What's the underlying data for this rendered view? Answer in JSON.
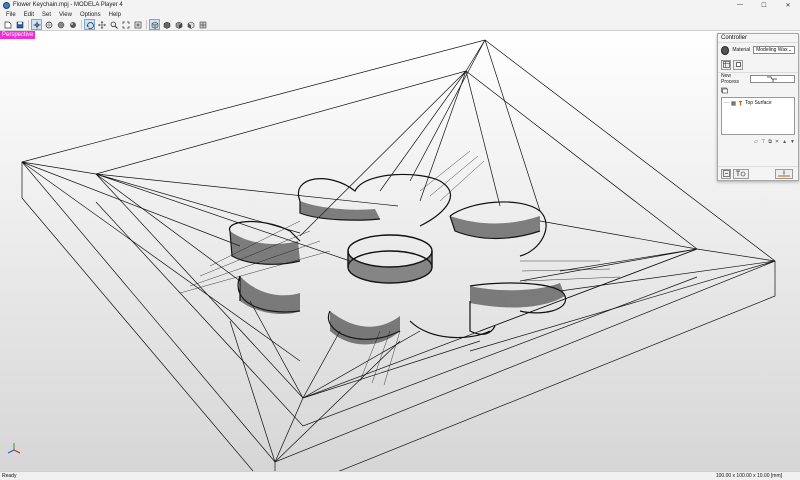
{
  "window": {
    "title": "Flower Keychain.mpj - MODELA Player 4",
    "controls": {
      "minimize": "—",
      "maximize": "☐",
      "close": "✕"
    }
  },
  "menu": [
    "File",
    "Edit",
    "Set",
    "View",
    "Options",
    "Help"
  ],
  "toolbar": {
    "icons": [
      "new-file-icon",
      "save-icon",
      "move-view-icon",
      "rotate-view-icon",
      "sphere-view-icon",
      "render-icon",
      "orbit-icon",
      "pan-icon",
      "zoom-icon",
      "fit-icon",
      "fit-all-icon",
      "wireframe-cube-icon",
      "solid-cube-icon",
      "shaded-cube-icon",
      "side-cube-icon",
      "grid-cube-icon"
    ]
  },
  "viewport": {
    "view_label": "Perspective",
    "label_color": "#ee2fd6"
  },
  "controller": {
    "title": "Controller",
    "material_label": "Material",
    "material_value": "Modeling Wax",
    "new_process_label": "New Process",
    "process_tree": [
      {
        "label": "Top Surface"
      }
    ]
  },
  "status": {
    "text": "Ready",
    "dimensions": "100.00 x 100.00 x 10.00 [mm]"
  }
}
